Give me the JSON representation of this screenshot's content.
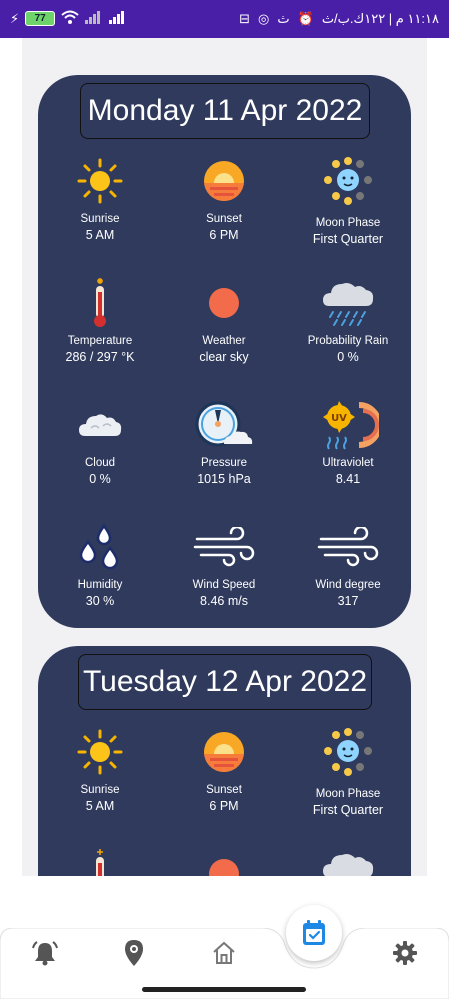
{
  "status_bar": {
    "battery": "77",
    "time": "١١:١٨ م | ١٢٢ك.ب/ث"
  },
  "days": [
    {
      "date": "Monday 11 Apr 2022",
      "metrics": [
        {
          "label": "Sunrise",
          "value": "5 AM",
          "icon": "sun-icon"
        },
        {
          "label": "Sunset",
          "value": "6 PM",
          "icon": "sunset-icon"
        },
        {
          "label": "Moon Phase",
          "value": "First Quarter",
          "icon": "moon-phase-icon"
        },
        {
          "label": "Temperature",
          "value": "286 / 297  °K",
          "icon": "thermometer-icon"
        },
        {
          "label": "Weather",
          "value": "clear sky",
          "icon": "clear-sky-icon"
        },
        {
          "label": "Probability Rain",
          "value": "0 %",
          "icon": "rain-cloud-icon"
        },
        {
          "label": "Cloud",
          "value": "0 %",
          "icon": "cloud-icon"
        },
        {
          "label": "Pressure",
          "value": "1015 hPa",
          "icon": "pressure-gauge-icon"
        },
        {
          "label": "Ultraviolet",
          "value": "8.41",
          "icon": "uv-icon"
        },
        {
          "label": "Humidity",
          "value": "30 %",
          "icon": "humidity-drops-icon"
        },
        {
          "label": "Wind Speed",
          "value": "8.46 m/s",
          "icon": "wind-icon"
        },
        {
          "label": "Wind degree",
          "value": "317",
          "icon": "wind-degree-icon"
        }
      ]
    },
    {
      "date": "Tuesday 12 Apr 2022",
      "metrics": [
        {
          "label": "Sunrise",
          "value": "5 AM",
          "icon": "sun-icon"
        },
        {
          "label": "Sunset",
          "value": "6 PM",
          "icon": "sunset-icon"
        },
        {
          "label": "Moon Phase",
          "value": "First Quarter",
          "icon": "moon-phase-icon"
        }
      ]
    }
  ],
  "nav": {
    "items": [
      "alerts-icon",
      "location-icon",
      "home-icon",
      "calendar-icon",
      "settings-icon"
    ],
    "active": "calendar-icon",
    "accent": "#1e88e5"
  },
  "colors": {
    "card_bg": "#2f3a5c",
    "status_bar": "#4a1fa8"
  }
}
